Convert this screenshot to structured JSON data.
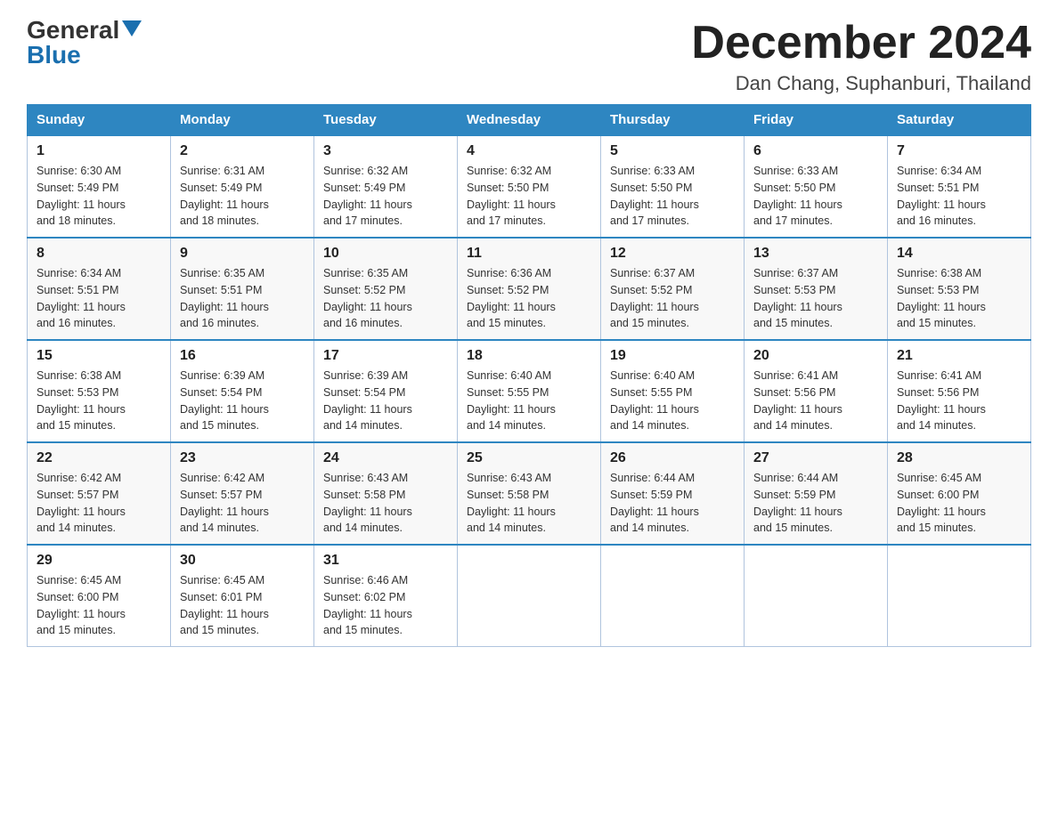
{
  "logo": {
    "general": "General",
    "blue": "Blue"
  },
  "title": "December 2024",
  "location": "Dan Chang, Suphanburi, Thailand",
  "days_of_week": [
    "Sunday",
    "Monday",
    "Tuesday",
    "Wednesday",
    "Thursday",
    "Friday",
    "Saturday"
  ],
  "weeks": [
    [
      {
        "day": "1",
        "sunrise": "6:30 AM",
        "sunset": "5:49 PM",
        "daylight": "11 hours and 18 minutes."
      },
      {
        "day": "2",
        "sunrise": "6:31 AM",
        "sunset": "5:49 PM",
        "daylight": "11 hours and 18 minutes."
      },
      {
        "day": "3",
        "sunrise": "6:32 AM",
        "sunset": "5:49 PM",
        "daylight": "11 hours and 17 minutes."
      },
      {
        "day": "4",
        "sunrise": "6:32 AM",
        "sunset": "5:50 PM",
        "daylight": "11 hours and 17 minutes."
      },
      {
        "day": "5",
        "sunrise": "6:33 AM",
        "sunset": "5:50 PM",
        "daylight": "11 hours and 17 minutes."
      },
      {
        "day": "6",
        "sunrise": "6:33 AM",
        "sunset": "5:50 PM",
        "daylight": "11 hours and 17 minutes."
      },
      {
        "day": "7",
        "sunrise": "6:34 AM",
        "sunset": "5:51 PM",
        "daylight": "11 hours and 16 minutes."
      }
    ],
    [
      {
        "day": "8",
        "sunrise": "6:34 AM",
        "sunset": "5:51 PM",
        "daylight": "11 hours and 16 minutes."
      },
      {
        "day": "9",
        "sunrise": "6:35 AM",
        "sunset": "5:51 PM",
        "daylight": "11 hours and 16 minutes."
      },
      {
        "day": "10",
        "sunrise": "6:35 AM",
        "sunset": "5:52 PM",
        "daylight": "11 hours and 16 minutes."
      },
      {
        "day": "11",
        "sunrise": "6:36 AM",
        "sunset": "5:52 PM",
        "daylight": "11 hours and 15 minutes."
      },
      {
        "day": "12",
        "sunrise": "6:37 AM",
        "sunset": "5:52 PM",
        "daylight": "11 hours and 15 minutes."
      },
      {
        "day": "13",
        "sunrise": "6:37 AM",
        "sunset": "5:53 PM",
        "daylight": "11 hours and 15 minutes."
      },
      {
        "day": "14",
        "sunrise": "6:38 AM",
        "sunset": "5:53 PM",
        "daylight": "11 hours and 15 minutes."
      }
    ],
    [
      {
        "day": "15",
        "sunrise": "6:38 AM",
        "sunset": "5:53 PM",
        "daylight": "11 hours and 15 minutes."
      },
      {
        "day": "16",
        "sunrise": "6:39 AM",
        "sunset": "5:54 PM",
        "daylight": "11 hours and 15 minutes."
      },
      {
        "day": "17",
        "sunrise": "6:39 AM",
        "sunset": "5:54 PM",
        "daylight": "11 hours and 14 minutes."
      },
      {
        "day": "18",
        "sunrise": "6:40 AM",
        "sunset": "5:55 PM",
        "daylight": "11 hours and 14 minutes."
      },
      {
        "day": "19",
        "sunrise": "6:40 AM",
        "sunset": "5:55 PM",
        "daylight": "11 hours and 14 minutes."
      },
      {
        "day": "20",
        "sunrise": "6:41 AM",
        "sunset": "5:56 PM",
        "daylight": "11 hours and 14 minutes."
      },
      {
        "day": "21",
        "sunrise": "6:41 AM",
        "sunset": "5:56 PM",
        "daylight": "11 hours and 14 minutes."
      }
    ],
    [
      {
        "day": "22",
        "sunrise": "6:42 AM",
        "sunset": "5:57 PM",
        "daylight": "11 hours and 14 minutes."
      },
      {
        "day": "23",
        "sunrise": "6:42 AM",
        "sunset": "5:57 PM",
        "daylight": "11 hours and 14 minutes."
      },
      {
        "day": "24",
        "sunrise": "6:43 AM",
        "sunset": "5:58 PM",
        "daylight": "11 hours and 14 minutes."
      },
      {
        "day": "25",
        "sunrise": "6:43 AM",
        "sunset": "5:58 PM",
        "daylight": "11 hours and 14 minutes."
      },
      {
        "day": "26",
        "sunrise": "6:44 AM",
        "sunset": "5:59 PM",
        "daylight": "11 hours and 14 minutes."
      },
      {
        "day": "27",
        "sunrise": "6:44 AM",
        "sunset": "5:59 PM",
        "daylight": "11 hours and 15 minutes."
      },
      {
        "day": "28",
        "sunrise": "6:45 AM",
        "sunset": "6:00 PM",
        "daylight": "11 hours and 15 minutes."
      }
    ],
    [
      {
        "day": "29",
        "sunrise": "6:45 AM",
        "sunset": "6:00 PM",
        "daylight": "11 hours and 15 minutes."
      },
      {
        "day": "30",
        "sunrise": "6:45 AM",
        "sunset": "6:01 PM",
        "daylight": "11 hours and 15 minutes."
      },
      {
        "day": "31",
        "sunrise": "6:46 AM",
        "sunset": "6:02 PM",
        "daylight": "11 hours and 15 minutes."
      },
      null,
      null,
      null,
      null
    ]
  ],
  "labels": {
    "sunrise": "Sunrise:",
    "sunset": "Sunset:",
    "daylight": "Daylight:"
  }
}
